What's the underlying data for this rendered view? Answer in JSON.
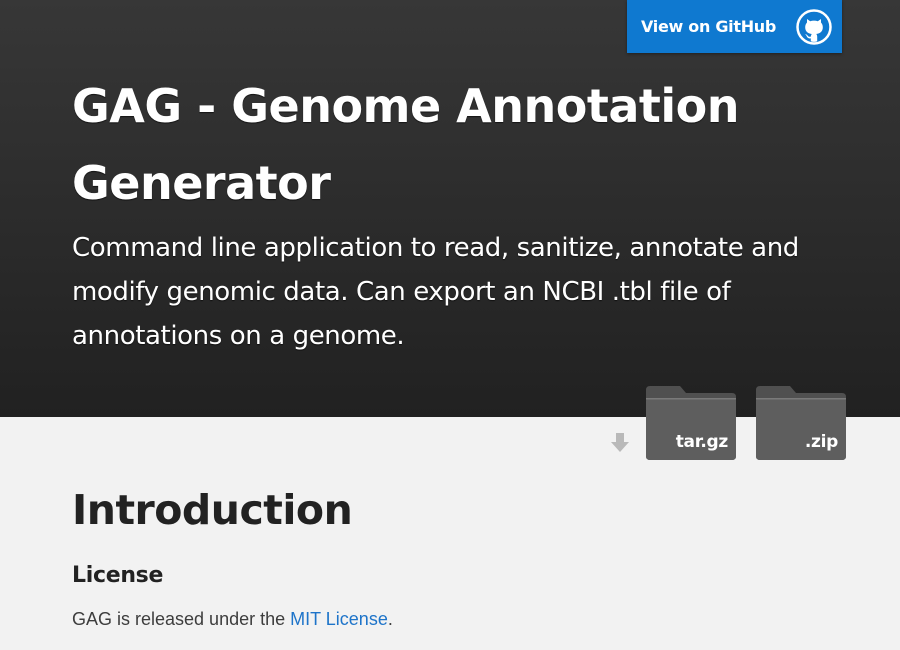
{
  "header": {
    "github_button_label": "View on GitHub",
    "title": "GAG - Genome Annotation Generator",
    "tagline": "Command line application to read, sanitize, annotate and modify genomic data. Can export an NCBI .tbl file of annotations on a genome."
  },
  "downloads": {
    "tar_label": "tar.gz",
    "zip_label": ".zip"
  },
  "main": {
    "heading": "Introduction",
    "license_heading": "License",
    "license_text_before": "GAG is released under the ",
    "license_link": "MIT License",
    "license_text_after": "."
  },
  "colors": {
    "header_bg": "#212121",
    "github_button_bg": "#0f79d0",
    "link": "#1e74c9",
    "page_bg": "#f2f2f2"
  },
  "icons": {
    "github": "github-octocat-icon",
    "download_arrow": "download-arrow-icon",
    "folder": "folder-icon"
  }
}
